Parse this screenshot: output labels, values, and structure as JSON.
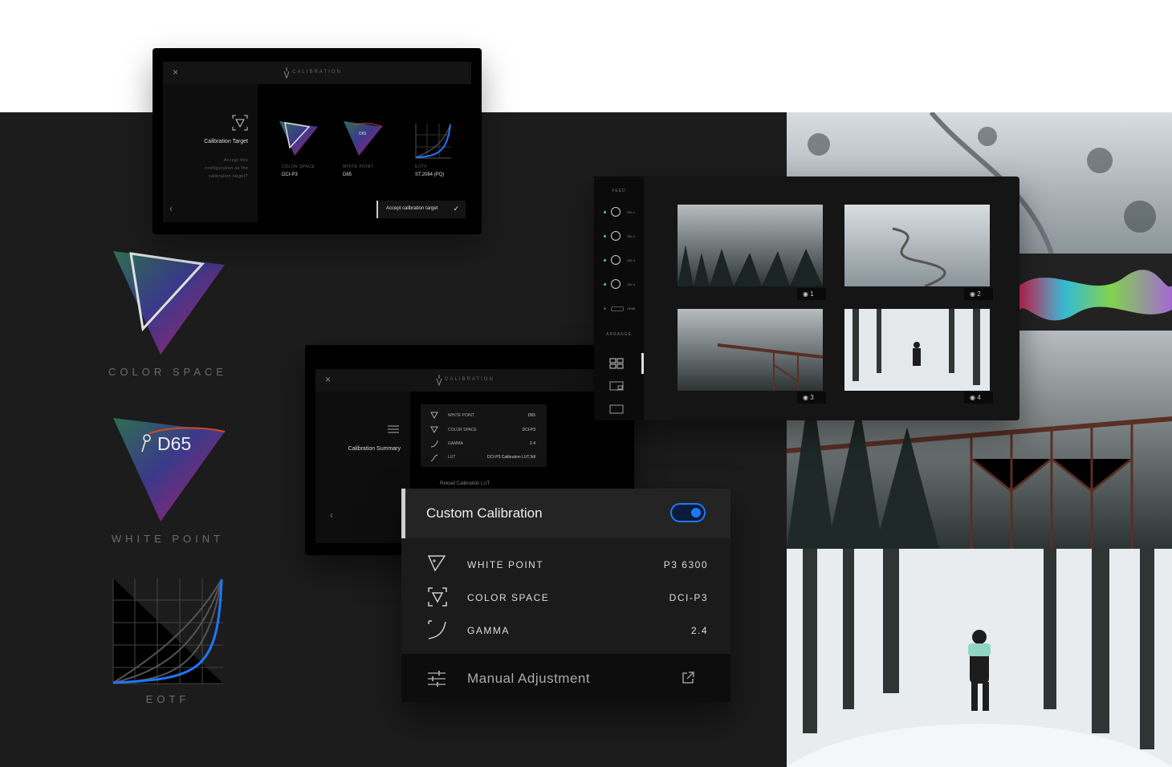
{
  "card1": {
    "title": "CALIBRATION",
    "close": "×",
    "section": "Calibration Target",
    "help": [
      "Accept this",
      "configuration as the",
      "calibration target?"
    ],
    "items": [
      {
        "label": "COLOR SPACE",
        "value": "DCI-P3"
      },
      {
        "label": "WHITE POINT",
        "value": "D65"
      },
      {
        "label": "EOTF",
        "value": "ST.2084 (PQ)"
      }
    ],
    "wp_badge": "D65",
    "accept": "Accept calibration target",
    "back": "‹"
  },
  "big": {
    "cs": "COLOR SPACE",
    "wp_badge": "D65",
    "wp": "WHITE POINT",
    "eotf": "EOTF"
  },
  "card2": {
    "title": "CALIBRATION",
    "close": "×",
    "section": "Calibration Summary",
    "back": "‹",
    "rows": [
      {
        "label": "WHITE POINT",
        "value": "D65"
      },
      {
        "label": "COLOR SPACE",
        "value": "DCI-P3"
      },
      {
        "label": "GAMMA",
        "value": "2.4"
      },
      {
        "label": "LUT",
        "value": "DCI-P3 Calibration LUT.3dl"
      }
    ],
    "reload": "Reload Calibration LUT"
  },
  "sources": {
    "feed": "FEED",
    "arrange": "ARRANGE",
    "inputs": [
      "SDI 1",
      "SDI 2",
      "SDI 3",
      "SDI 4",
      "HDMI"
    ],
    "captions": [
      "1",
      "2",
      "3",
      "4"
    ]
  },
  "custom": {
    "title": "Custom Calibration",
    "toggle_on": true,
    "rows": [
      {
        "label": "WHITE POINT",
        "value": "P3 6300"
      },
      {
        "label": "COLOR SPACE",
        "value": "DCI-P3"
      },
      {
        "label": "GAMMA",
        "value": "2.4"
      }
    ],
    "manual": "Manual Adjustment"
  },
  "colors": {
    "accent": "#1e78ff",
    "dark_bg": "#1c1c1c",
    "green": "#4cd964"
  }
}
